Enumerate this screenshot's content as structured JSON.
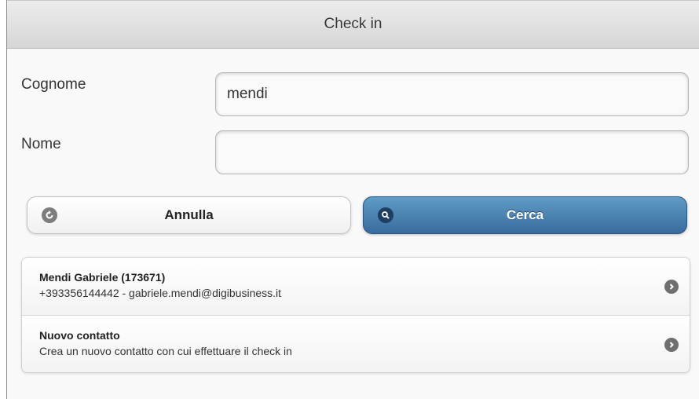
{
  "header": {
    "title": "Check in"
  },
  "form": {
    "cognome": {
      "label": "Cognome",
      "value": "mendi",
      "placeholder": ""
    },
    "nome": {
      "label": "Nome",
      "value": "",
      "placeholder": ""
    }
  },
  "buttons": {
    "cancel": {
      "label": "Annulla",
      "icon": "back-arrow-icon"
    },
    "search": {
      "label": "Cerca",
      "icon": "search-icon"
    }
  },
  "results": [
    {
      "title": "Mendi Gabriele (173671)",
      "subtitle": "+393356144442 - gabriele.mendi@digibusiness.it",
      "icon": "chevron-right-icon"
    },
    {
      "title": "Nuovo contatto",
      "subtitle": "Crea un nuovo contatto con cui effettuare il check in",
      "icon": "chevron-right-icon"
    }
  ],
  "colors": {
    "primary_button": "#396b9e",
    "header_bg": "#dcdcdc",
    "icon_gray": "#7d7d7d"
  }
}
